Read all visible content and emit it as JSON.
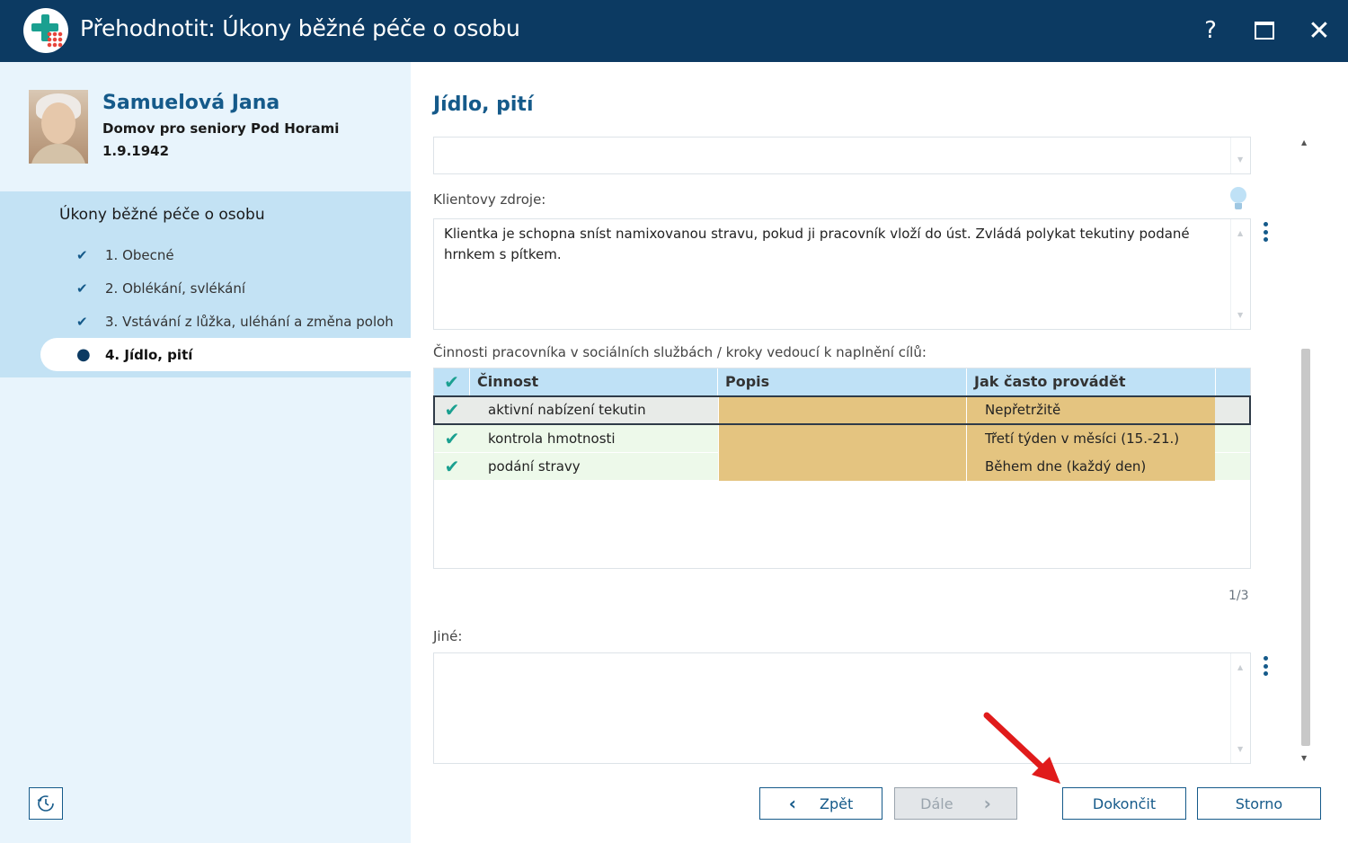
{
  "window": {
    "title": "Přehodnotit: Úkony běžné péče o osobu",
    "help_label": "?",
    "close_label": "✕"
  },
  "patient": {
    "name": "Samuelová Jana",
    "facility": "Domov pro seniory Pod Horami",
    "dob": "1.9.1942"
  },
  "nav": {
    "title": "Úkony běžné péče o osobu",
    "items": [
      {
        "label": "1. Obecné",
        "mark": "✔"
      },
      {
        "label": "2. Oblékání, svlékání",
        "mark": "✔"
      },
      {
        "label": "3. Vstávání z lůžka, uléhání a změna poloh",
        "mark": "✔"
      },
      {
        "label": "4. Jídlo, pití",
        "mark": "●"
      }
    ]
  },
  "main": {
    "section_title": "Jídlo, pití",
    "top_field_value": "",
    "resources_label": "Klientovy zdroje:",
    "resources_value": "Klientka je schopna sníst namixovanou stravu, pokud ji pracovník vloží do úst. Zvládá polykat tekutiny podané hrnkem s pítkem.",
    "activities_label": "Činnosti pracovníka v sociálních službách / kroky vedoucí k naplnění cílů:",
    "table": {
      "headers": {
        "check": "✔",
        "activity": "Činnost",
        "description": "Popis",
        "frequency": "Jak často provádět"
      },
      "rows": [
        {
          "check": "✔",
          "activity": "aktivní nabízení tekutin",
          "description": "",
          "frequency": "Nepřetržitě"
        },
        {
          "check": "✔",
          "activity": "kontrola hmotnosti",
          "description": "",
          "frequency": "Třetí týden v měsíci (15.-21.)"
        },
        {
          "check": "✔",
          "activity": "podání stravy",
          "description": "",
          "frequency": "Během dne (každý den)"
        }
      ],
      "counter": "1/3"
    },
    "other_label": "Jiné:",
    "other_value": ""
  },
  "footer": {
    "back_label": "Zpět",
    "next_label": "Dále",
    "finish_label": "Dokončit",
    "cancel_label": "Storno"
  },
  "colors": {
    "titlebar": "#0c3a62",
    "accent": "#155a8a",
    "check": "#1aa090",
    "highlight_cell": "#e4c480",
    "annotation_arrow": "#e01b1b"
  },
  "icons": {
    "app": "app-logo-icon",
    "history": "history-icon",
    "hint": "lightbulb-icon",
    "menu": "kebab-menu-icon"
  }
}
